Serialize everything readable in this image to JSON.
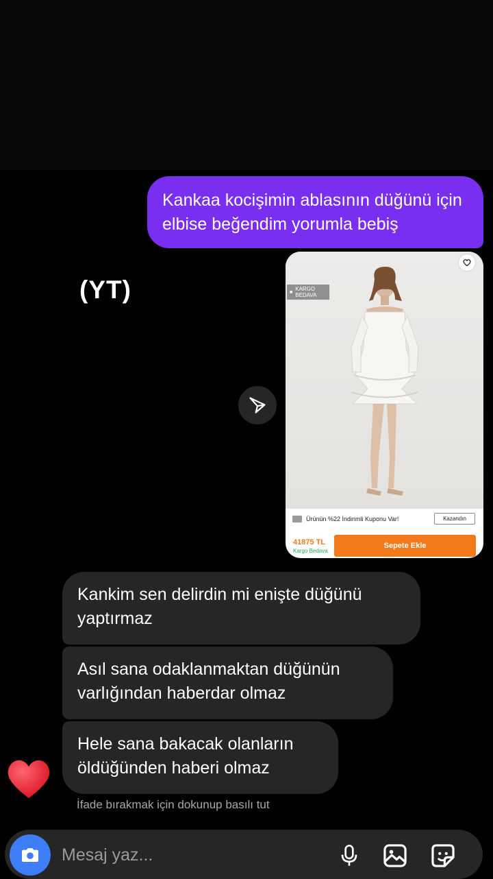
{
  "thread": {
    "outgoing_message": "Kankaa kocişimin ablasının düğünü için elbise beğendim yorumla bebiş",
    "overlay_label": "(YT)",
    "product_card": {
      "cargo_tag": "KARGO BEDAVA",
      "coupon_text": "Ürünün %22 İndirimli Kuponu Var!",
      "coupon_button": "Kazandın",
      "price": "41875 TL",
      "price_sub": "Kargo Bedava",
      "add_to_cart": "Sepete Ekle"
    },
    "incoming_messages": [
      "Kankim sen delirdin mi enişte düğünü yaptırmaz",
      "Asıl sana odaklanmaktan düğünün varlığından haberdar olmaz",
      "Hele sana bakacak olanların öldüğünden haberi olmaz"
    ],
    "reaction_hint": "İfade bırakmak için dokunup basılı tut"
  },
  "composer": {
    "placeholder": "Mesaj yaz..."
  },
  "colors": {
    "outgoing_bubble": "#7a2ff0",
    "incoming_bubble": "#262626",
    "camera_button": "#3d7df5",
    "cart_orange": "#f27a1a",
    "heart": "#e8202e"
  },
  "icons": {
    "share": "paper-plane-icon",
    "favorite": "heart-outline-icon",
    "camera": "camera-icon",
    "mic": "microphone-icon",
    "gallery": "image-icon",
    "sticker": "sticker-icon",
    "reaction": "red-heart-icon"
  }
}
